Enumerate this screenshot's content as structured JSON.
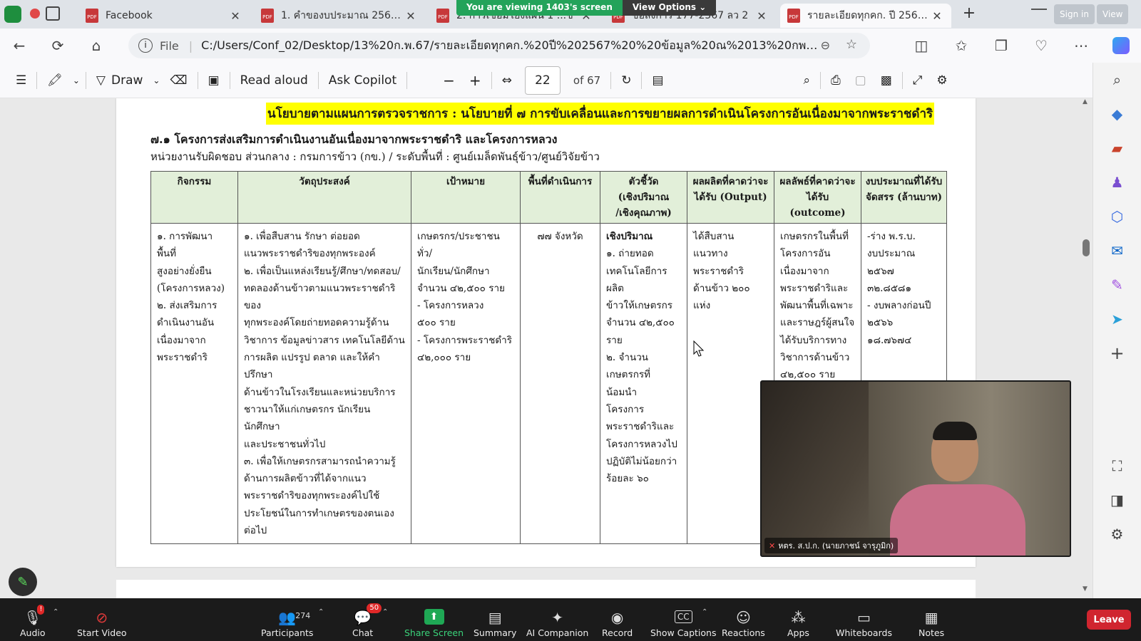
{
  "browser": {
    "tabs": [
      {
        "title": "Facebook"
      },
      {
        "title": "รายละเอียดทุกคก. ปี 2567 ข้"
      },
      {
        "title": "1. คำของบประมาณ 2567 ข้"
      },
      {
        "title": "2. การเชื่อมโยงแผน 1 ...ข้"
      },
      {
        "title": "ข้อสั่งการ 177-2567 ลว 2"
      },
      {
        "title": "รายละเอียดทุกคก. ปี 2567 ข้"
      }
    ],
    "new_tab": "+",
    "signin": "Sign in",
    "view": "View",
    "file_label": "File",
    "url": "C:/Users/Conf_02/Desktop/13%20ก.พ.67/รายละเอียดทุกคก.%20ปี%202567%20%20ข้อมูล%20ณ%2013%20กพ%206..."
  },
  "share_banner": {
    "text": "You are viewing 1403's screen",
    "options": "View Options"
  },
  "pdf_toolbar": {
    "draw": "Draw",
    "read_aloud": "Read aloud",
    "ask_copilot": "Ask Copilot",
    "page": "22",
    "of_pages": "of 67"
  },
  "doc": {
    "header": "นโยบายตามแผนการตรวจราชการ : นโยบายที่ ๗ การขับเคลื่อนและการขยายผลการดำเนินโครงการอันเนื่องมาจากพระราชดำริ",
    "subheading": "๗.๑ โครงการส่งเสริมการดำเนินงานอันเนื่องมาจากพระราชดำริ และโครงการหลวง",
    "unit_line": "หน่วยงานรับผิดชอบ ส่วนกลาง : กรมการข้าว (กข.) / ระดับพื้นที่ : ศูนย์เมล็ดพันธุ์ข้าว/ศูนย์วิจัยข้าว",
    "columns": [
      "กิจกรรม",
      "วัตถุประสงค์",
      "เป้าหมาย",
      "พื้นที่ดำเนินการ",
      "ตัวชี้วัด\n(เชิงปริมาณ\n/เชิงคุณภาพ)",
      "ผลผลิตที่คาดว่าจะ\nได้รับ (Output)",
      "ผลลัพธ์ที่คาดว่าจะ\nได้รับ (outcome)",
      "งบประมาณที่ได้รับ\nจัดสรร (ล้านบาท)"
    ],
    "row": {
      "activity": "๑. การพัฒนาพื้นที่\nสูงอย่างยั่งยืน\n(โครงการหลวง)\n๒. ส่งเสริมการ\nดำเนินงานอัน\nเนื่องมาจาก\nพระราชดำริ",
      "objective": "๑. เพื่อสืบสาน รักษา ต่อยอด\nแนวพระราชดำริของทุกพระองค์\n๒. เพื่อเป็นแหล่งเรียนรู้/ศึกษา/ทดสอบ/\nทดลองด้านข้าวตามแนวพระราชดำริของ\nทุกพระองค์โดยถ่ายทอดความรู้ด้าน\nวิชาการ ข้อมูลข่าวสาร เทคโนโลยีด้าน\nการผลิต แปรรูป ตลาด และให้คำปรึกษา\nด้านข้าวในโรงเรียนและหน่วยบริการ\nชาวนาให้แก่เกษตรกร นักเรียน นักศึกษา\nและประชาชนทั่วไป\n๓. เพื่อให้เกษตรกรสามารถนำความรู้\nด้านการผลิตข้าวที่ได้จากแนว\nพระราชดำริของทุกพระองค์ไปใช้\nประโยชน์ในการทำเกษตรของตนเอง\nต่อไป",
      "target": "เกษตรกร/ประชาชนทั่ว/\nนักเรียน/นักศึกษา\nจำนวน ๔๒,๕๐๐ ราย\n- โครงการหลวง\n   ๕๐๐ ราย\n-  โครงการพระราชดำริ\n๔๒,๐๐๐ ราย",
      "area": "๗๗ จังหวัด",
      "indicator_title": "เชิงปริมาณ",
      "indicator": "๑. ถ่ายทอด\nเทคโนโลยีการผลิต\nข้าวให้เกษตรกร\nจำนวน ๔๒,๕๐๐\nราย\n๒. จำนวน\nเกษตรกรที่น้อมนำ\nโครงการ\nพระราชดำริและ\nโครงการหลวงไป\nปฏิบัติไม่น้อยกว่า\nร้อยละ ๖๐",
      "output": "ได้สืบสานแนวทาง\nพระราชดำริ\nด้านข้าว ๒๐๐\nแห่ง",
      "outcome": "เกษตรกรในพื้นที่\nโครงการอัน\nเนื่องมาจาก\nพระราชดำริและ\nพัฒนาพื้นที่เฉพาะ\nและราษฎร์ผู้สนใจ\nได้รับบริการทาง\nวิชาการด้านข้าว\n๔๒,๕๐๐ ราย",
      "budget": "-ร่าง พ.ร.บ.\nงบประมาณ\n๒๕๖๗\n     ๓๒.๘๕๘๑\n- งบพลางก่อนปี\n๒๕๖๖\n     ๑๘.๗๖๗๔"
    }
  },
  "video": {
    "name": "หตร. ส.ป.ก. (นายภาชน์ จารุภูมิก)"
  },
  "zoom": {
    "audio": "Audio",
    "start_video": "Start Video",
    "participants": "Participants",
    "participants_count": "274",
    "chat": "Chat",
    "chat_badge": "50",
    "share_screen": "Share Screen",
    "summary": "Summary",
    "ai_companion": "AI Companion",
    "record": "Record",
    "show_captions": "Show Captions",
    "reactions": "Reactions",
    "apps": "Apps",
    "whiteboards": "Whiteboards",
    "notes": "Notes",
    "leave": "Leave"
  }
}
